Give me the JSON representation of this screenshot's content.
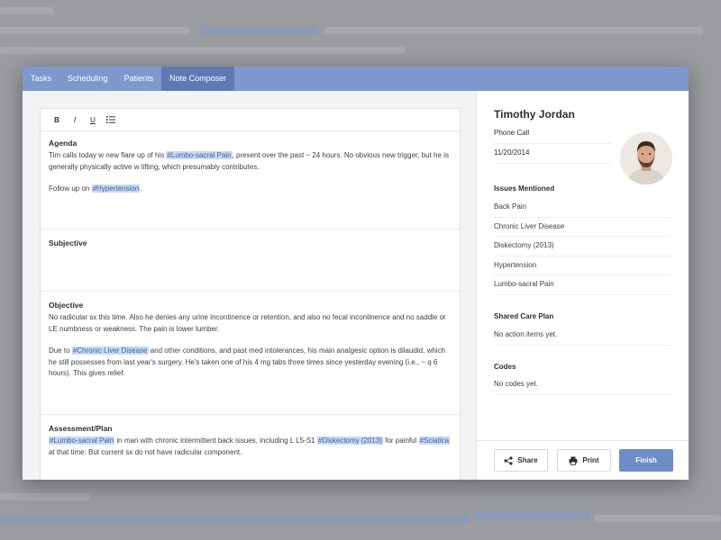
{
  "tabs": [
    {
      "label": "Tasks"
    },
    {
      "label": "Scheduling"
    },
    {
      "label": "Patients"
    },
    {
      "label": "Note Composer"
    }
  ],
  "toolbar": {
    "bold": "B",
    "italic": "I",
    "underline": "U",
    "list_icon": "bulleted-list-icon"
  },
  "note": {
    "agenda": {
      "title": "Agenda",
      "p1_a": "Tim calls today w new flare up of his ",
      "p1_tag": "#Lumbo-sacral Pain",
      "p1_b": ", present over the past ~ 24 hours. No obvious new trigger, but he is generally physically active w lifting, which presumably contributes.",
      "p2_a": "Follow up on ",
      "p2_tag": "#Hypertension",
      "p2_b": "."
    },
    "subjective": {
      "title": "Subjective"
    },
    "objective": {
      "title": "Objective",
      "p1": "No radicular sx this time. Also he denies any urine incontinence or retention, and also no fecal incontinence and no saddle or LE numbness or weakness. The pain is lower lumber.",
      "p2_a": "Due to ",
      "p2_tag": "#Chronic Liver Disease",
      "p2_b": " and other conditions, and past med intolerances, his main analgesic option is dilaudid, which he still possesses from last year's surgery. He's taken one of his 4 mg tabs three times since yesterday evening (i.e., ~ q 6 hours). This gives relief."
    },
    "assessment": {
      "title": "Assessment/Plan",
      "tag1": "#Lumbo-sacral Pain",
      "t1": " in man with chronic intermittent back issues, including L L5-S1 ",
      "tag2": "#Diskectomy (2013)",
      "t2": " for painful ",
      "tag3": "#Sciatica",
      "t3": " at that time. But current sx do not have radicular component."
    }
  },
  "patient": {
    "name": "Timothy Jordan",
    "contact_type": "Phone Call",
    "date": "11/20/2014",
    "avatar_icon": "patient-photo"
  },
  "issues": {
    "title": "Issues Mentioned",
    "items": [
      "Back Pain",
      "Chronic Liver Disease",
      "Diskectomy (2013)",
      "Hypertension",
      "Lumbo-sacral Pain"
    ]
  },
  "care_plan": {
    "title": "Shared Care Plan",
    "empty": "No action items yet."
  },
  "codes": {
    "title": "Codes",
    "empty": "No codes yet."
  },
  "actions": {
    "share": "Share",
    "share_icon": "share-icon",
    "print": "Print",
    "print_icon": "printer-icon",
    "finish": "Finish"
  },
  "colors": {
    "accent": "#7d98cc",
    "active_tab": "#5f7ab3",
    "tag_bg": "#c9daf2",
    "tag_text": "#3d63a6",
    "primary_button": "#6d8cc8"
  }
}
